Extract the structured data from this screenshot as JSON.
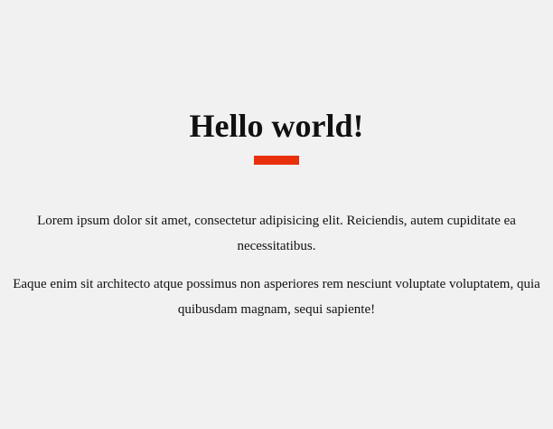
{
  "header": {
    "title": "Hello world!",
    "accent_color": "#e8300c"
  },
  "content": {
    "paragraphs": [
      "Lorem ipsum dolor sit amet, consectetur adipisicing elit. Reiciendis, autem cupiditate ea necessitatibus.",
      "Eaque enim sit architecto atque possimus non asperiores rem nesciunt voluptate voluptatem, quia quibusdam magnam, sequi sapiente!"
    ]
  },
  "theme": {
    "background": "#f1f1f1",
    "text": "#111111"
  }
}
